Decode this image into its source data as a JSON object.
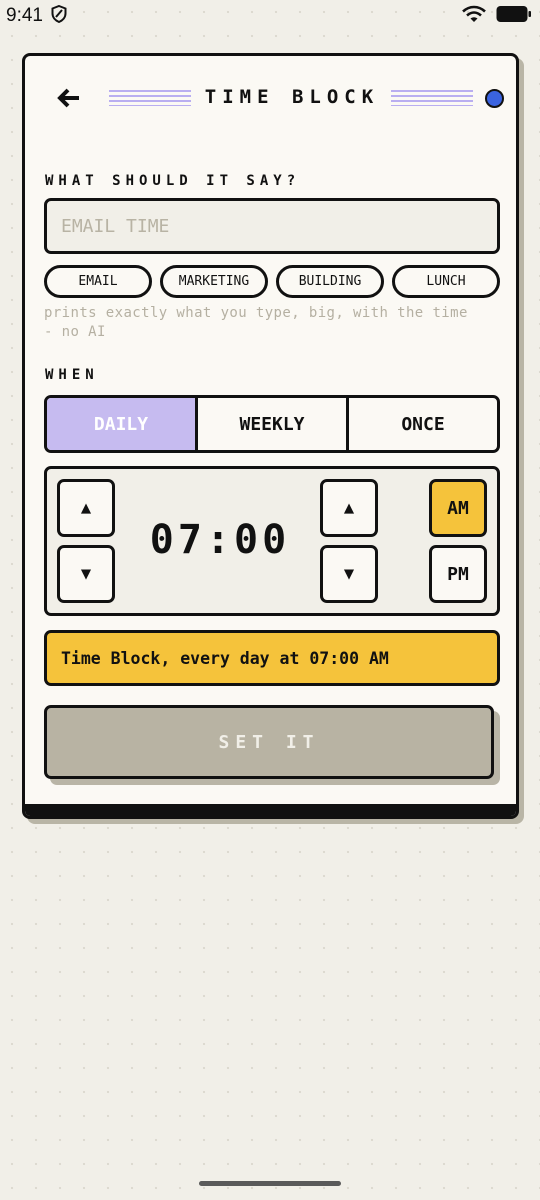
{
  "status_bar": {
    "time": "9:41",
    "icons": [
      "shield-icon",
      "wifi-icon",
      "battery-icon"
    ]
  },
  "header": {
    "title": "TIME BLOCK",
    "back_icon": "arrow-left-icon",
    "status_dot_color": "#3a63e0"
  },
  "form": {
    "message_label": "WHAT SHOULD IT SAY?",
    "message_input": {
      "value": "",
      "placeholder": "EMAIL TIME"
    },
    "suggestions": [
      "EMAIL",
      "MARKETING",
      "BUILDING",
      "LUNCH"
    ],
    "hint": "prints exactly what you type, big, with the time - no AI",
    "when_label": "WHEN",
    "frequency": {
      "options": [
        "DAILY",
        "WEEKLY",
        "ONCE"
      ],
      "selected": "DAILY"
    },
    "time": {
      "hour": "07",
      "minute": "00",
      "separator": ":",
      "up_glyph": "▲",
      "down_glyph": "▼",
      "am_label": "AM",
      "pm_label": "PM",
      "period": "AM"
    },
    "summary": "Time Block, every day at 07:00 AM",
    "submit_label": "SET IT"
  },
  "colors": {
    "accent_purple": "#c6bbf0",
    "accent_yellow": "#f5c33b",
    "disabled_button": "#b8b3a3",
    "background": "#f1efe8",
    "card": "#fbf9f4"
  }
}
